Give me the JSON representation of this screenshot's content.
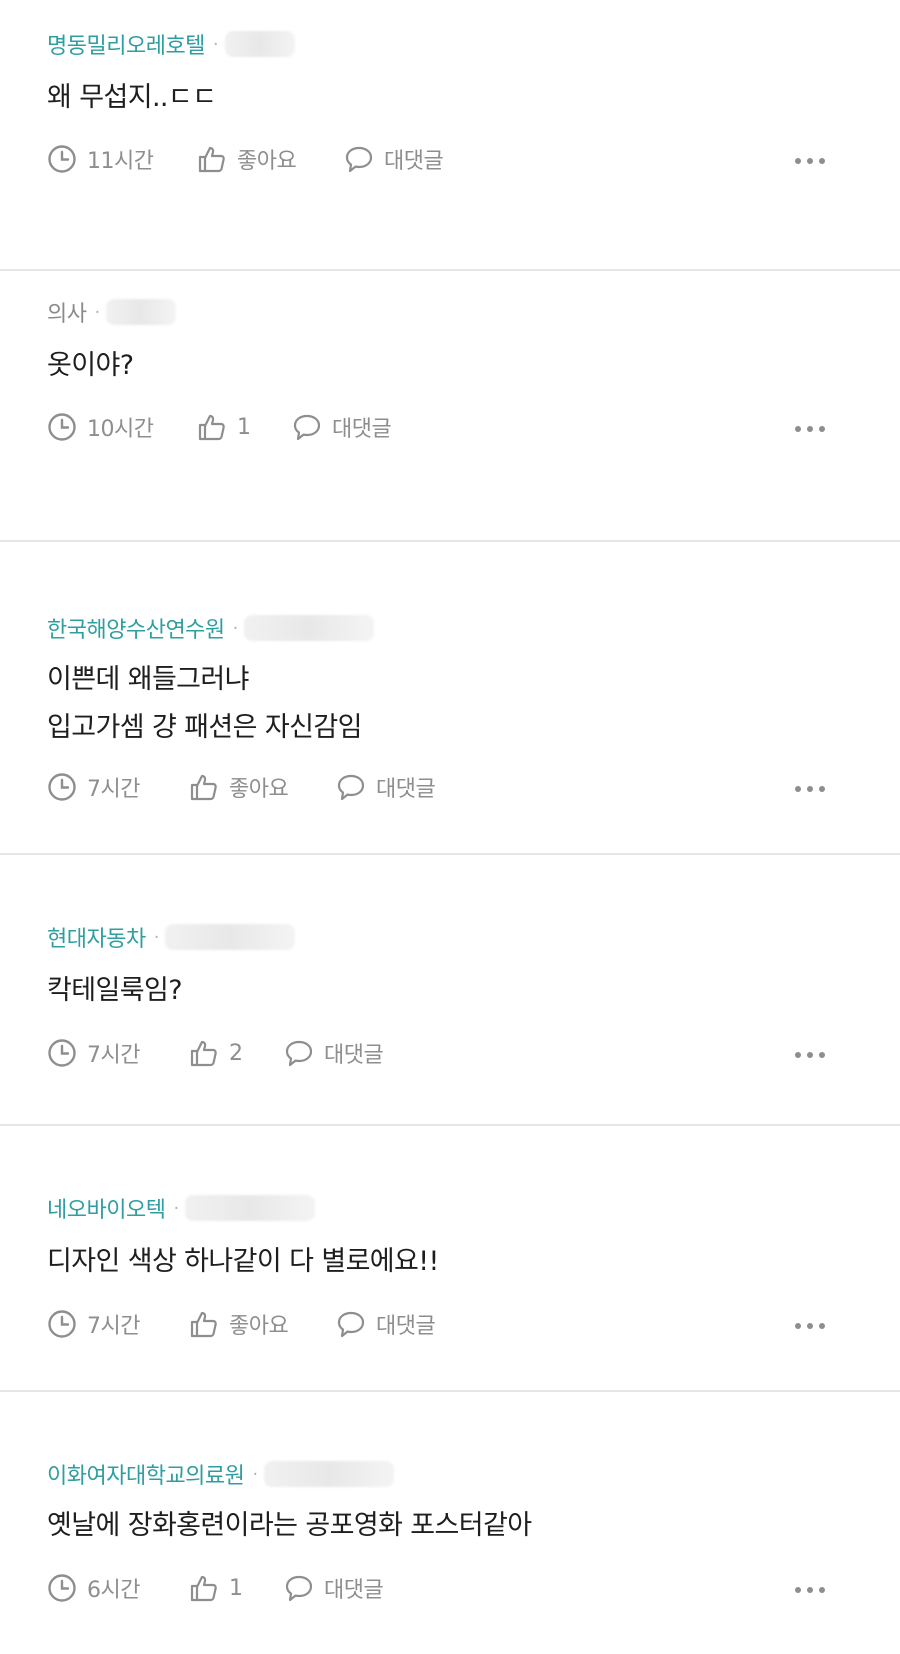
{
  "comments": [
    {
      "author": "명동밀리오레호텔",
      "author_style": "company",
      "text": "왜 무섭지..ㄷㄷ",
      "time": "11시간",
      "like": "좋아요",
      "reply": "대댓글"
    },
    {
      "author": "의사",
      "author_style": "plain",
      "text": "옷이야?",
      "time": "10시간",
      "like": "1",
      "reply": "대댓글"
    },
    {
      "author": "한국해양수산연수원",
      "author_style": "company",
      "text": "이쁜데 왜들그러냐\n입고가셈 걍 패션은 자신감임",
      "time": "7시간",
      "like": "좋아요",
      "reply": "대댓글"
    },
    {
      "author": "현대자동차",
      "author_style": "company",
      "text": "칵테일룩임?",
      "time": "7시간",
      "like": "2",
      "reply": "대댓글"
    },
    {
      "author": "네오바이오텍",
      "author_style": "company",
      "text": "디자인 색상 하나같이 다 별로에요!!",
      "time": "7시간",
      "like": "좋아요",
      "reply": "대댓글"
    },
    {
      "author": "이화여자대학교의료원",
      "author_style": "company",
      "text": "옛날에 장화홍련이라는 공포영화 포스터같아",
      "time": "6시간",
      "like": "1",
      "reply": "대댓글"
    }
  ],
  "colors": {
    "company_author": "#2f9ea0",
    "plain_author": "#8a8a8a",
    "meta": "#8e8e8e",
    "divider": "#e6e6e6"
  },
  "icons": [
    "clock-icon",
    "thumbs-up-icon",
    "speech-bubble-icon",
    "more-dots-icon"
  ]
}
